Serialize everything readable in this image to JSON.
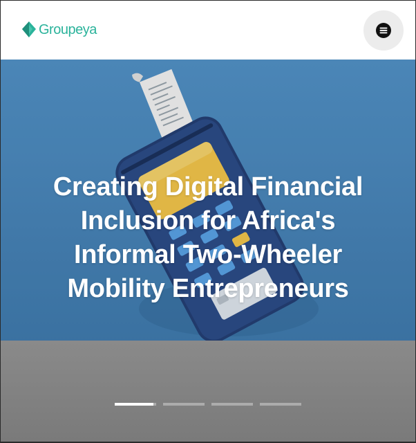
{
  "header": {
    "logo_text": "Groupeya",
    "logo_icon": "diamond-leaf-icon",
    "menu_icon": "hamburger-menu-icon"
  },
  "hero": {
    "title": "Creating Digital Financial Inclusion for Africa's Informal Two-Wheeler Mobility Entrepreneurs",
    "slides": [
      {
        "active": true
      },
      {
        "active": false
      },
      {
        "active": false
      },
      {
        "active": false
      }
    ]
  },
  "colors": {
    "brand": "#2bb39b",
    "hero_blue": "#3f7db2",
    "overlay_gray": "#808080"
  }
}
